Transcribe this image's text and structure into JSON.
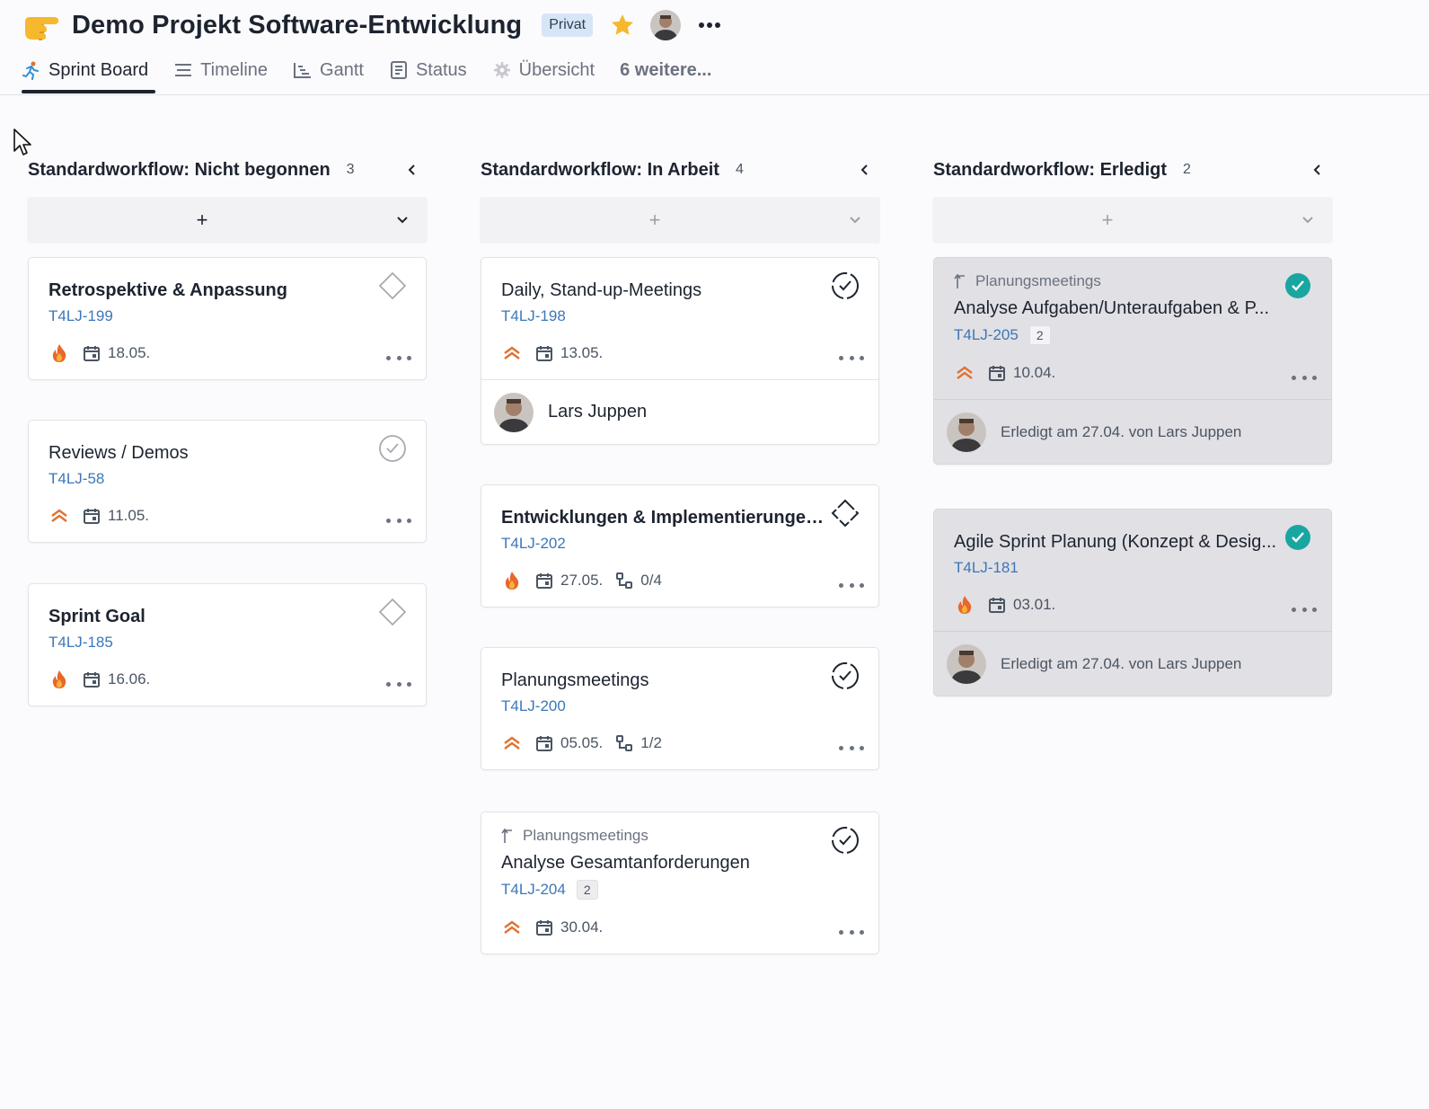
{
  "project": {
    "title": "Demo Projekt Software-Entwicklung",
    "badge": "Privat",
    "icon": "pointing-hand-icon",
    "more_icon": "more-horizontal-icon"
  },
  "tabs": [
    {
      "label": "Sprint Board",
      "icon": "runner-icon",
      "active": true
    },
    {
      "label": "Timeline",
      "icon": "lines-icon"
    },
    {
      "label": "Gantt",
      "icon": "gantt-icon"
    },
    {
      "label": "Status",
      "icon": "document-icon"
    },
    {
      "label": "Übersicht",
      "icon": "gear-icon"
    },
    {
      "label": "6 weitere..."
    }
  ],
  "colors": {
    "accent": "#1d2430",
    "link": "#3c77b8",
    "priority_orange": "#e0732f",
    "done_teal": "#1aa6a0",
    "star": "#f5b82e"
  },
  "columns": [
    {
      "title": "Standardworkflow: Nicht begonnen",
      "count": "3",
      "add_label": "+",
      "cards": [
        {
          "title": "Retrospektive & Anpassung",
          "key": "T4LJ-199",
          "date": "18.05.",
          "priority": "fire",
          "status": "diamond"
        },
        {
          "title": "Reviews / Demos",
          "key": "T4LJ-58",
          "date": "11.05.",
          "priority": "chevrons",
          "status": "check-circle-gray"
        },
        {
          "title": "Sprint Goal",
          "key": "T4LJ-185",
          "date": "16.06.",
          "priority": "fire",
          "status": "diamond"
        }
      ]
    },
    {
      "title": "Standardworkflow: In Arbeit",
      "count": "4",
      "add_label": "+",
      "cards": [
        {
          "title": "Daily, Stand-up-Meetings",
          "key": "T4LJ-198",
          "date": "13.05.",
          "priority": "chevrons",
          "status": "progress-check",
          "assignee": "Lars Juppen"
        },
        {
          "title": "Entwicklungen & Implementierungen ...",
          "key": "T4LJ-202",
          "date": "27.05.",
          "subtasks": "0/4",
          "priority": "fire",
          "status": "diamond-progress"
        },
        {
          "title": "Planungsmeetings",
          "key": "T4LJ-200",
          "date": "05.05.",
          "subtasks": "1/2",
          "priority": "chevrons",
          "status": "progress-check"
        },
        {
          "parent": "Planungsmeetings",
          "title": "Analyse Gesamtanforderungen",
          "key": "T4LJ-204",
          "badge": "2",
          "date": "30.04.",
          "priority": "chevrons",
          "status": "progress-check"
        }
      ]
    },
    {
      "title": "Standardworkflow: Erledigt",
      "count": "2",
      "add_label": "+",
      "cards": [
        {
          "parent": "Planungsmeetings",
          "title": "Analyse Aufgaben/Unteraufgaben & P...",
          "key": "T4LJ-205",
          "badge": "2",
          "date": "10.04.",
          "priority": "chevrons",
          "status": "done",
          "done_text": "Erledigt am 27.04. von Lars Juppen"
        },
        {
          "title": "Agile Sprint Planung (Konzept & Desig...",
          "key": "T4LJ-181",
          "date": "03.01.",
          "priority": "fire",
          "status": "done",
          "done_text": "Erledigt am 27.04. von Lars Juppen"
        }
      ]
    }
  ]
}
